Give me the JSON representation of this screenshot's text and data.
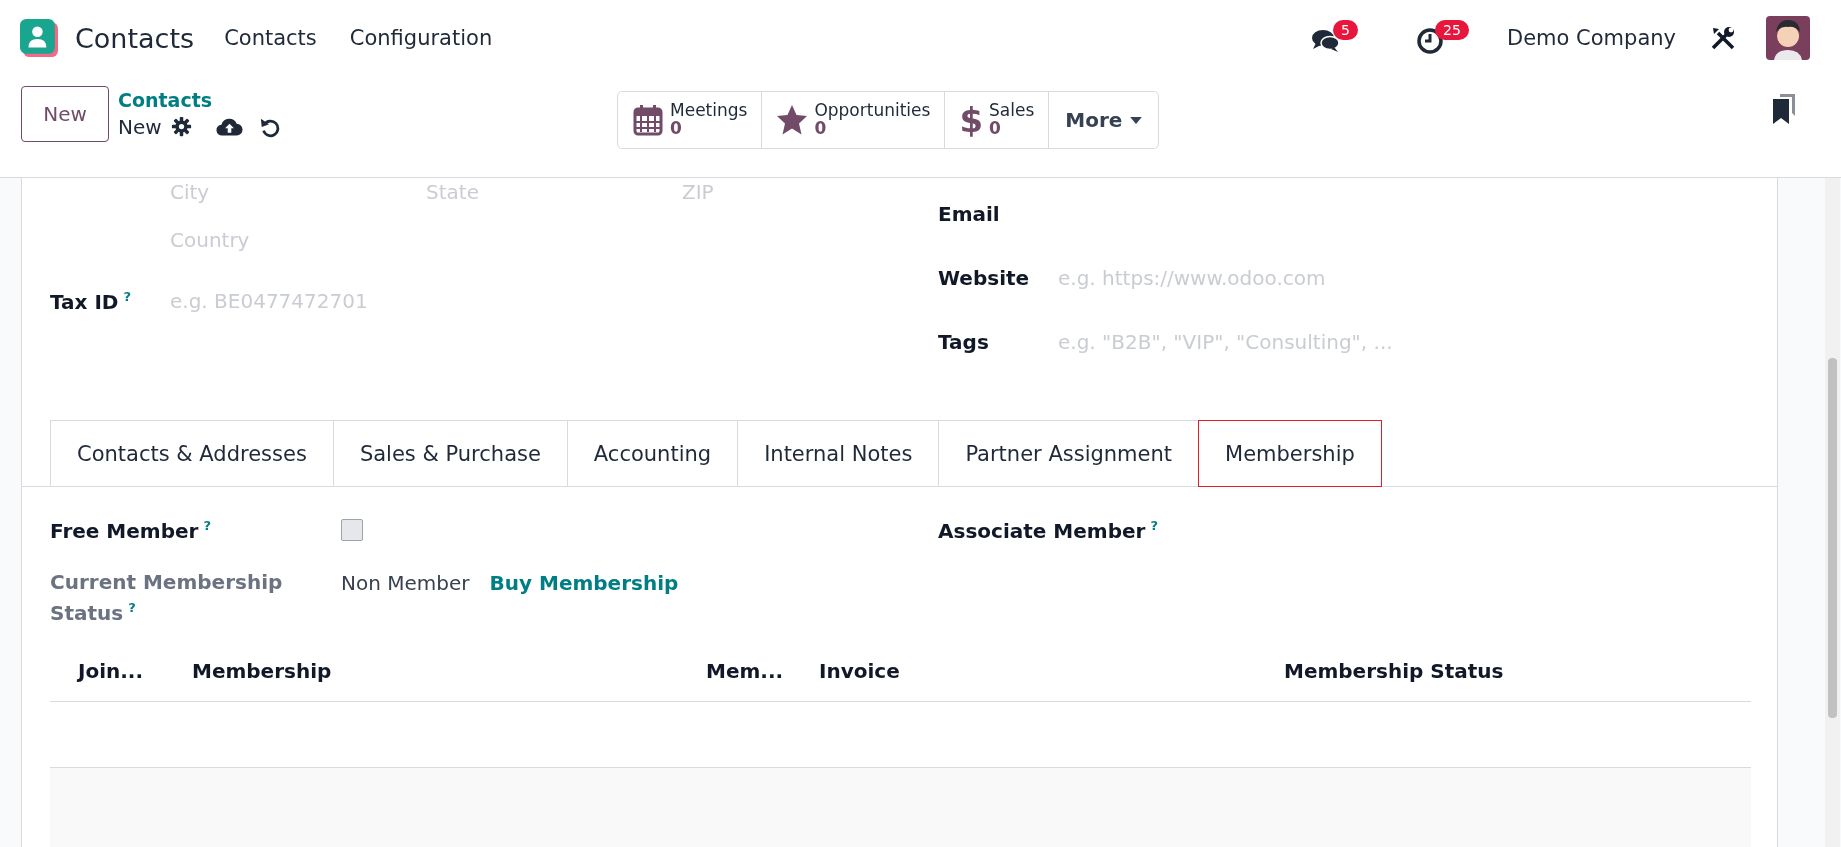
{
  "app": {
    "name": "Contacts",
    "menu": [
      {
        "label": "Contacts"
      },
      {
        "label": "Configuration"
      }
    ]
  },
  "systray": {
    "messages_badge": "5",
    "activities_badge": "25",
    "company": "Demo Company"
  },
  "control_panel": {
    "new_button": "New",
    "breadcrumb": {
      "parent": "Contacts",
      "current": "New"
    },
    "stat_buttons": [
      {
        "kind": "calendar",
        "label": "Meetings",
        "value": "0"
      },
      {
        "kind": "star",
        "label": "Opportunities",
        "value": "0"
      },
      {
        "kind": "dollar",
        "icon": "$",
        "label": "Sales",
        "value": "0"
      }
    ],
    "more_button": "More"
  },
  "form": {
    "address_placeholders": [
      "City",
      "State",
      "ZIP"
    ],
    "country_placeholder": "Country",
    "tax_id": {
      "label": "Tax ID",
      "help": "?",
      "placeholder": "e.g. BE0477472701"
    },
    "right_fields": [
      {
        "label": "Email"
      },
      {
        "label": "Website",
        "placeholder": "e.g. https://www.odoo.com"
      },
      {
        "label": "Tags",
        "placeholder": "e.g. \"B2B\", \"VIP\", \"Consulting\", ..."
      }
    ]
  },
  "tabs": [
    {
      "label": "Contacts & Addresses",
      "selected": false
    },
    {
      "label": "Sales & Purchase",
      "selected": false
    },
    {
      "label": "Accounting",
      "selected": false
    },
    {
      "label": "Internal Notes",
      "selected": false
    },
    {
      "label": "Partner Assignment",
      "selected": false
    },
    {
      "label": "Membership",
      "selected": true
    }
  ],
  "membership": {
    "free_member": {
      "label": "Free Member",
      "help": "?",
      "checked": false
    },
    "associate_member": {
      "label": "Associate Member",
      "help": "?"
    },
    "status": {
      "label": "Current Membership Status",
      "help": "?",
      "value": "Non Member",
      "action": "Buy Membership"
    },
    "table": {
      "columns": [
        {
          "label": "Join..."
        },
        {
          "label": "Membership"
        },
        {
          "label": "Mem..."
        },
        {
          "label": "Invoice"
        },
        {
          "label": "Membership Status"
        }
      ]
    }
  }
}
